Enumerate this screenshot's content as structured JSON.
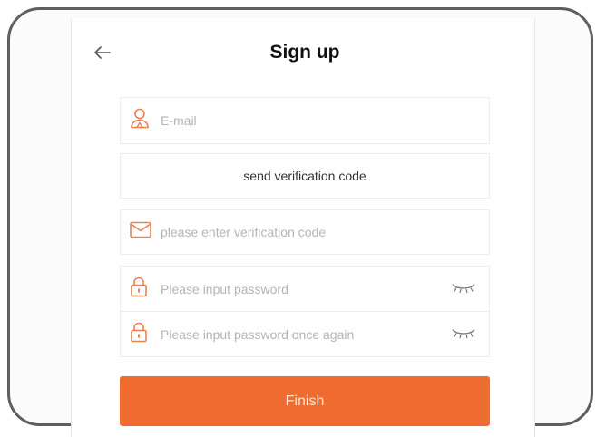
{
  "header": {
    "back_icon": "arrow-left-icon",
    "title": "Sign up"
  },
  "form": {
    "email": {
      "placeholder": "E-mail",
      "icon": "person-icon"
    },
    "send_code_label": "send verification code",
    "code": {
      "placeholder": "please enter verification code",
      "icon": "envelope-icon"
    },
    "password": {
      "placeholder": "Please input password",
      "icon": "lock-icon",
      "toggle_icon": "eye-closed-icon"
    },
    "password_confirm": {
      "placeholder": "Please input password once again",
      "icon": "lock-icon",
      "toggle_icon": "eye-closed-icon"
    },
    "finish_label": "Finish"
  },
  "colors": {
    "accent": "#f06b2e",
    "icon": "#e8824f"
  }
}
